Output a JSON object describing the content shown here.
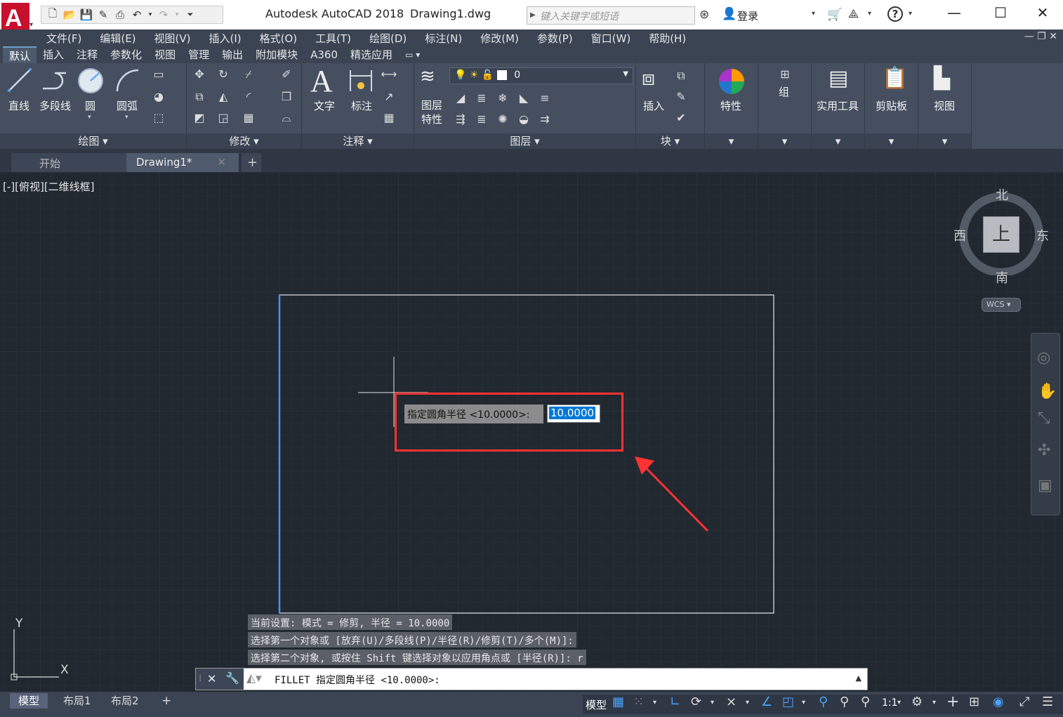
{
  "titlebar": {
    "app_title": "Autodesk AutoCAD 2018",
    "doc_title": "Drawing1.dwg",
    "search_placeholder": "键入关键字或短语",
    "login_label": "登录"
  },
  "menu": [
    "文件(F)",
    "编辑(E)",
    "视图(V)",
    "插入(I)",
    "格式(O)",
    "工具(T)",
    "绘图(D)",
    "标注(N)",
    "修改(M)",
    "参数(P)",
    "窗口(W)",
    "帮助(H)"
  ],
  "ribbon_tabs": [
    "默认",
    "插入",
    "注释",
    "参数化",
    "视图",
    "管理",
    "输出",
    "附加模块",
    "A360",
    "精选应用"
  ],
  "ribbon": {
    "draw": {
      "title": "绘图",
      "line": "直线",
      "polyline": "多段线",
      "circle": "圆",
      "arc": "圆弧"
    },
    "modify": {
      "title": "修改"
    },
    "annotation": {
      "title": "注释",
      "text": "文字",
      "dimension": "标注"
    },
    "layers": {
      "title": "图层",
      "layer_props_1": "图层",
      "layer_props_2": "特性",
      "current_layer": "0"
    },
    "block": {
      "title": "块",
      "insert": "插入"
    },
    "properties": {
      "label": "特性"
    },
    "groups": {
      "label": "组"
    },
    "utilities": {
      "label": "实用工具"
    },
    "clipboard": {
      "label": "剪贴板"
    },
    "view": {
      "label": "视图"
    }
  },
  "doc_tabs": {
    "start": "开始",
    "drawing": "Drawing1*"
  },
  "viewport_label": "[-][俯视][二维线框]",
  "viewcube": {
    "north": "北",
    "south": "南",
    "east": "东",
    "west": "西",
    "top": "上",
    "wcs": "WCS"
  },
  "ucs": {
    "x": "X",
    "y": "Y"
  },
  "dynamic_input": {
    "prompt": "指定圆角半径 <10.0000>:",
    "value": "10.0000"
  },
  "command_history": [
    "当前设置: 模式 = 修剪, 半径 = 10.0000",
    "选择第一个对象或 [放弃(U)/多段线(P)/半径(R)/修剪(T)/多个(M)]:",
    "选择第二个对象, 或按住 Shift 键选择对象以应用角点或 [半径(R)]: r"
  ],
  "command_line": "FILLET 指定圆角半径 <10.0000>:",
  "layout_tabs": [
    "模型",
    "布局1",
    "布局2"
  ],
  "status": {
    "model": "模型",
    "scale": "1:1"
  },
  "colors": {
    "accent": "#ff3333",
    "selection": "#0078d7",
    "canvas": "#212830"
  }
}
